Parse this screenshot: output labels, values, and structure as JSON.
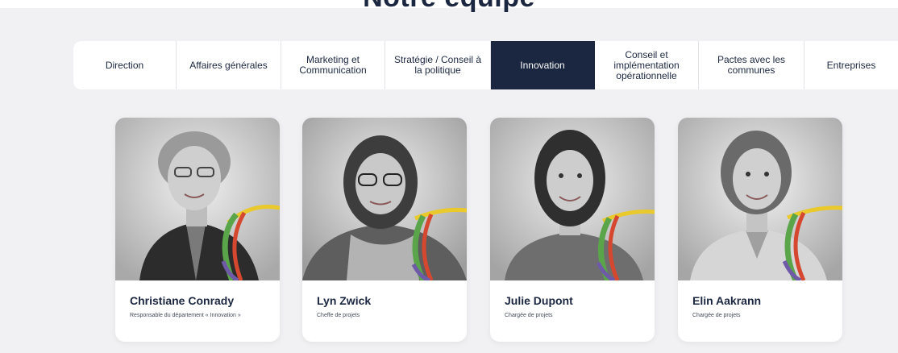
{
  "section": {
    "heading": "Notre équipe"
  },
  "tabs": [
    {
      "label": "Direction",
      "active": false
    },
    {
      "label": "Affaires générales",
      "active": false
    },
    {
      "label": "Marketing et Communication",
      "active": false
    },
    {
      "label": "Stratégie / Conseil à la politique",
      "active": false
    },
    {
      "label": "Innovation",
      "active": true
    },
    {
      "label": "Conseil et implémentation opérationnelle",
      "active": false
    },
    {
      "label": "Pactes avec les communes",
      "active": false
    },
    {
      "label": "Entreprises",
      "active": false
    }
  ],
  "team": [
    {
      "name": "Christiane Conrady",
      "role": "Responsable du département « Innovation »"
    },
    {
      "name": "Lyn Zwick",
      "role": "Cheffe de projets"
    },
    {
      "name": "Julie Dupont",
      "role": "Chargée de projets"
    },
    {
      "name": "Elin Aakrann",
      "role": "Chargée de projets"
    }
  ],
  "colors": {
    "navy": "#1b2740",
    "ribbon_yellow": "#e9c92b",
    "ribbon_green": "#5aa54a",
    "ribbon_red": "#d5482f",
    "ribbon_purple": "#6f5aa8"
  }
}
